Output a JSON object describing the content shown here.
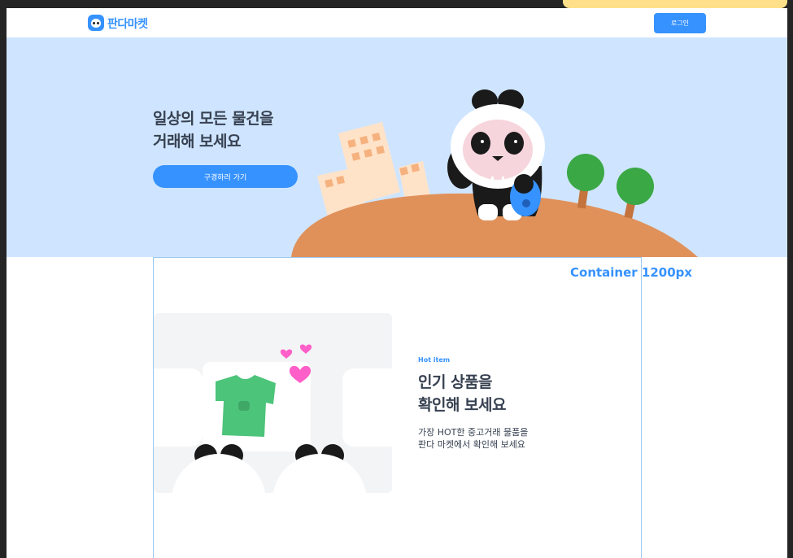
{
  "header": {
    "logo_text": "판다마켓",
    "login_label": "로그인"
  },
  "hero": {
    "title_line1": "일상의 모든 물건을",
    "title_line2": "거래해 보세요",
    "cta_label": "구경하러 가기"
  },
  "container_label": "Container 1200px",
  "section": {
    "eyebrow": "Hot item",
    "title_line1": "인기 상품을",
    "title_line2": "확인해 보세요",
    "desc_line1": "가장 HOT한 중고거래 물품을",
    "desc_line2": "판다 마켓에서 확인해 보세요"
  },
  "colors": {
    "brand": "#3692ff",
    "hero_bg": "#cfe5ff",
    "text": "#374151",
    "hill": "#e0915a",
    "tree": "#3aa845",
    "shirt": "#4cc47a",
    "heart": "#ff5fc8"
  },
  "icons": [
    "panda-logo-icon",
    "buildings-illustration",
    "panda-mascot-illustration",
    "tree-icon",
    "tshirt-icon",
    "heart-icon",
    "panda-ears-illustration"
  ]
}
